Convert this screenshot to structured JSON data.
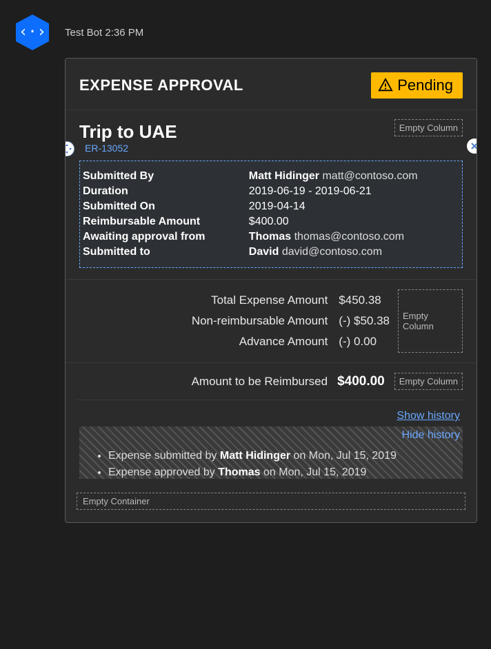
{
  "bot": {
    "name": "Test Bot",
    "time": "2:36 PM"
  },
  "card": {
    "title": "EXPENSE APPROVAL",
    "status": "Pending",
    "tripTitle": "Trip to UAE",
    "refId": "ER-13052",
    "emptyColumnLabel": "Empty Column",
    "emptyContainerLabel": "Empty Container",
    "details": {
      "submittedBy": {
        "label": "Submitted By",
        "name": "Matt Hidinger",
        "email": "matt@contoso.com"
      },
      "duration": {
        "label": "Duration",
        "value": "2019-06-19 - 2019-06-21"
      },
      "submittedOn": {
        "label": "Submitted On",
        "value": "2019-04-14"
      },
      "reimbursable": {
        "label": "Reimbursable Amount",
        "value": "$400.00"
      },
      "awaiting": {
        "label": "Awaiting approval from",
        "name": "Thomas",
        "email": "thomas@contoso.com"
      },
      "submittedTo": {
        "label": "Submitted to",
        "name": "David",
        "email": "david@contoso.com"
      }
    },
    "totals": {
      "totalExpense": {
        "label": "Total Expense Amount",
        "value": "$450.38"
      },
      "nonReimbursable": {
        "label": "Non-reimbursable Amount",
        "value": "(-) $50.38"
      },
      "advance": {
        "label": "Advance Amount",
        "value": "(-) 0.00"
      }
    },
    "reimburse": {
      "label": "Amount to be Reimbursed",
      "value": "$400.00"
    },
    "history": {
      "showLabel": "Show history",
      "hideLabel": "Hide history",
      "items": [
        {
          "prefix": "Expense submitted by ",
          "actor": "Matt Hidinger",
          "suffix": " on Mon, Jul 15, 2019"
        },
        {
          "prefix": "Expense approved by ",
          "actor": "Thomas",
          "suffix": " on Mon, Jul 15, 2019"
        }
      ]
    }
  }
}
